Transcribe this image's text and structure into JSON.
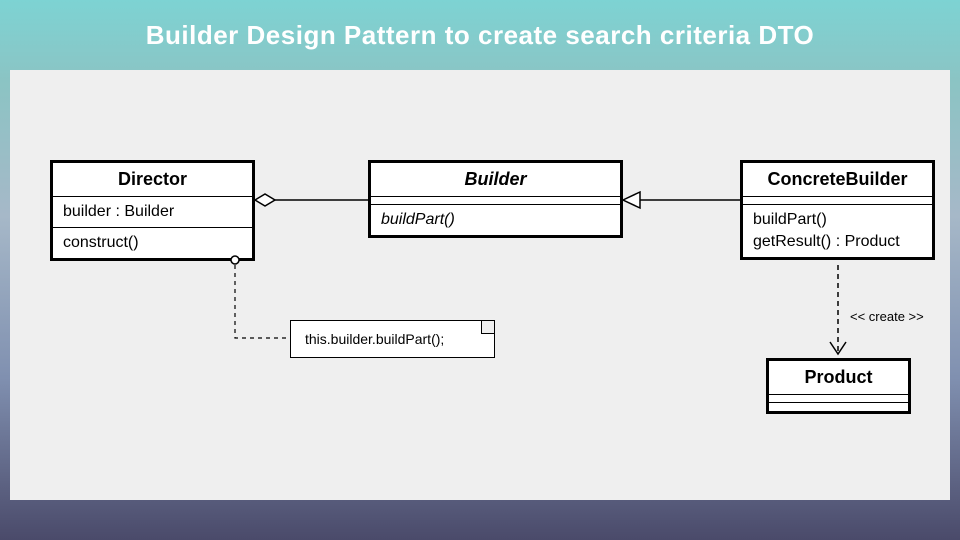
{
  "title": "Builder Design Pattern to create search criteria DTO",
  "classes": {
    "director": {
      "name": "Director",
      "attributes": [
        "builder : Builder"
      ],
      "methods": [
        "construct()"
      ]
    },
    "builder": {
      "name": "Builder",
      "methods": [
        "buildPart()"
      ]
    },
    "concrete": {
      "name": "ConcreteBuilder",
      "methods": [
        "buildPart()",
        "getResult() : Product"
      ]
    },
    "product": {
      "name": "Product"
    }
  },
  "note": "this.builder.buildPart();",
  "stereotype": "<< create >>",
  "relations": [
    {
      "from": "Director",
      "to": "Builder",
      "type": "aggregation"
    },
    {
      "from": "ConcreteBuilder",
      "to": "Builder",
      "type": "realization"
    },
    {
      "from": "ConcreteBuilder",
      "to": "Product",
      "type": "dependency",
      "stereotype": "<< create >>"
    },
    {
      "from": "Director.construct()",
      "to": "note",
      "type": "note-anchor"
    }
  ]
}
